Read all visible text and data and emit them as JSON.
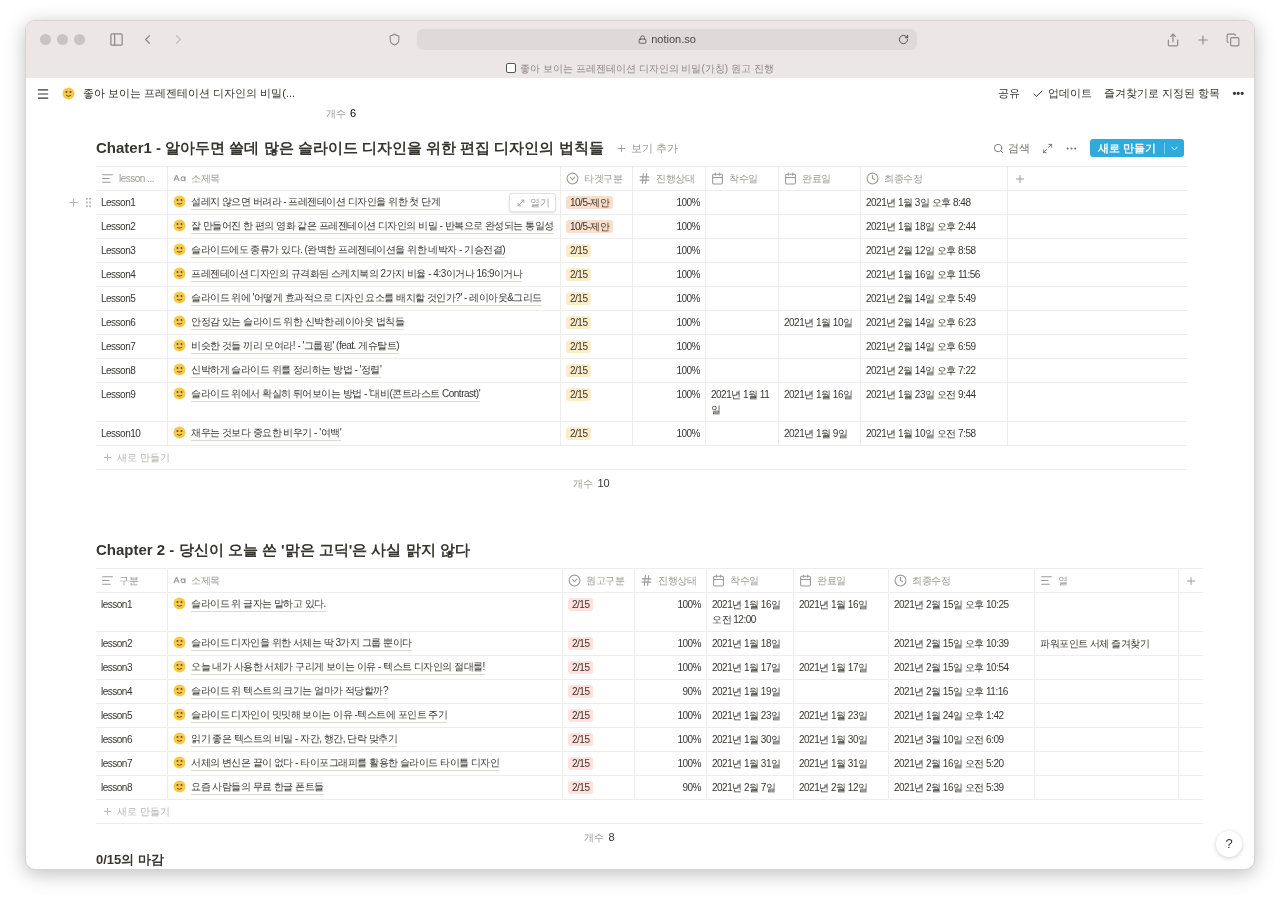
{
  "browser": {
    "url": "notion.so",
    "tab_title": "좋아 보이는 프레젠테이션 디자인의 비밀(가칭) 원고 진행"
  },
  "topbar": {
    "page_title": "좋아 보이는 프레젠테이션 디자인의 비밀(...",
    "actions": [
      {
        "kind": "text",
        "label": "공유"
      },
      {
        "kind": "check",
        "label": "업데이트"
      },
      {
        "kind": "text",
        "label": "즐겨찾기로 지정된 항목"
      },
      {
        "kind": "more",
        "label": "•••"
      }
    ]
  },
  "prev_count": {
    "label": "개수",
    "value": "6"
  },
  "tables": [
    {
      "title": "Chater1 - 알아두면 쓸데 많은 슬라이드 디자인을 위한 편집 디자인의 법칙들",
      "add_view": "보기 추가",
      "search": "검색",
      "new_button": "새로 만들기",
      "columns": [
        {
          "kind": "text",
          "label": "lesson ..."
        },
        {
          "kind": "title",
          "label": "소제목"
        },
        {
          "kind": "select",
          "label": "타겟구분"
        },
        {
          "kind": "number",
          "label": "진행상태"
        },
        {
          "kind": "date",
          "label": "착수일"
        },
        {
          "kind": "date",
          "label": "완료일"
        },
        {
          "kind": "clock",
          "label": "최종수정"
        },
        {
          "kind": "add"
        }
      ],
      "rows": [
        {
          "lesson": "Lesson1",
          "title": "설레지 않으면 버려라 - 프레젠테이션 디자인을 위한 첫 단계",
          "open_label": "열기",
          "tag": {
            "label": "10/5-제안",
            "color": "#fadec9"
          },
          "progress": "100%",
          "modified": "2021년 1월 3일 오후 8:48"
        },
        {
          "lesson": "Lesson2",
          "title": "잘 만들어진 한 편의 영화 같은 프레젠테이션 디자인의 비밀 - 반복으로 완성되는 통일성",
          "tag": {
            "label": "10/5-제안",
            "color": "#fadec9"
          },
          "progress": "100%",
          "modified": "2021년 1월 18일 오후 2:44"
        },
        {
          "lesson": "Lesson3",
          "title": "슬라이드에도 종류가 있다. (완벽한 프레젠테이션을 위한 네박자 - 기승전결)",
          "tag": {
            "label": "2/15",
            "color": "#fdecc8"
          },
          "progress": "100%",
          "modified": "2021년 2월 12일 오후 8:58"
        },
        {
          "lesson": "Lesson4",
          "title": "프레젠테이션 디자인의 규격화된 스케치북의 2가지 비율 - 4:3이거나 16:9이거나",
          "tag": {
            "label": "2/15",
            "color": "#fdecc8"
          },
          "progress": "100%",
          "modified": "2021년 1월 16일 오후 11:56"
        },
        {
          "lesson": "Lesson5",
          "title": "슬라이드 위에 '어떻게 효과적으로 디자인 요소를 배치할 것인가?' - 레이아웃&그리드",
          "tag": {
            "label": "2/15",
            "color": "#fdecc8"
          },
          "progress": "100%",
          "modified": "2021년 2월 14일 오후 5:49"
        },
        {
          "lesson": "Lesson6",
          "title": "안정감 있는 슬라이드 위한 신박한 레이아웃 법칙들",
          "tag": {
            "label": "2/15",
            "color": "#fdecc8"
          },
          "progress": "100%",
          "end": "2021년 1월 10일",
          "modified": "2021년 2월 14일 오후 6:23"
        },
        {
          "lesson": "Lesson7",
          "title": "비슷한 것들 끼리 모여라! - '그룹핑' (feat. 게슈탈트)",
          "tag": {
            "label": "2/15",
            "color": "#fdecc8"
          },
          "progress": "100%",
          "modified": "2021년 2월 14일 오후 6:59"
        },
        {
          "lesson": "Lesson8",
          "title": "신박하게 슬라이드 위를 정리하는 방법 - '정렬'",
          "tag": {
            "label": "2/15",
            "color": "#fdecc8"
          },
          "progress": "100%",
          "modified": "2021년 2월 14일 오후 7:22"
        },
        {
          "lesson": "Lesson9",
          "title": "슬라이드 위에서 확실히 튀어보이는 방법 - '대비(콘트라스트 Contrast)'",
          "tag": {
            "label": "2/15",
            "color": "#fdecc8"
          },
          "progress": "100%",
          "start": "2021년 1월 11일",
          "end": "2021년 1월 16일",
          "modified": "2021년 1월 23일 오전 9:44"
        },
        {
          "lesson": "Lesson10",
          "title": "채우는 것보다 중요한 비우기 - '여백'",
          "tag": {
            "label": "2/15",
            "color": "#fdecc8"
          },
          "progress": "100%",
          "end": "2021년 1월 9일",
          "modified": "2021년 1월 10일 오전 7:58"
        }
      ],
      "new_row": "새로 만들기",
      "count": {
        "label": "개수",
        "value": "10"
      }
    },
    {
      "title": "Chapter 2 - 당신이 오늘 쓴 '맑은 고딕'은 사실 맑지 않다",
      "columns": [
        {
          "kind": "text",
          "label": "구분"
        },
        {
          "kind": "title",
          "label": "소제목"
        },
        {
          "kind": "select",
          "label": "원고구분"
        },
        {
          "kind": "number",
          "label": "진행상태"
        },
        {
          "kind": "date",
          "label": "착수일"
        },
        {
          "kind": "date",
          "label": "완료일"
        },
        {
          "kind": "clock",
          "label": "최종수정"
        },
        {
          "kind": "text",
          "label": "열"
        },
        {
          "kind": "add"
        }
      ],
      "rows": [
        {
          "lesson": "lesson1",
          "title": "슬라이드 위 글자는 말하고 있다.",
          "tag": {
            "label": "2/15",
            "color": "#ffe2dd"
          },
          "progress": "100%",
          "start": "2021년 1월 16일 오전 12:00",
          "end": "2021년 1월 16일",
          "modified": "2021년 2월 15일 오후 10:25"
        },
        {
          "lesson": "lesson2",
          "title": "슬라이드 디자인을 위한 서체는 딱 3가지 그룹 뿐이다",
          "tag": {
            "label": "2/15",
            "color": "#ffe2dd"
          },
          "progress": "100%",
          "start": "2021년 1월 18일",
          "modified": "2021년 2월 15일 오후 10:39",
          "note": "파워포인트 서체 즐겨찾기"
        },
        {
          "lesson": "lesson3",
          "title": "오늘 내가 사용한 서체가 구리게 보이는 이유 - 텍스트 디자인의 절대룰!",
          "tag": {
            "label": "2/15",
            "color": "#ffe2dd"
          },
          "progress": "100%",
          "start": "2021년 1월 17일",
          "end": "2021년 1월 17일",
          "modified": "2021년 2월 15일 오후 10:54"
        },
        {
          "lesson": "lesson4",
          "title": "슬라이드 위 텍스트의 크기는 얼마가 적당할까?",
          "tag": {
            "label": "2/15",
            "color": "#ffe2dd"
          },
          "progress": "90%",
          "start": "2021년 1월 19일",
          "modified": "2021년 2월 15일 오후 11:16"
        },
        {
          "lesson": "lesson5",
          "title": "슬라이드 디자인이 밋밋해 보이는 이유 -텍스트에 포인트 주기",
          "tag": {
            "label": "2/15",
            "color": "#ffe2dd"
          },
          "progress": "100%",
          "start": "2021년 1월 23일",
          "end": "2021년 1월 23일",
          "modified": "2021년 1월 24일 오후 1:42"
        },
        {
          "lesson": "lesson6",
          "title": "읽기 좋은 텍스트의 비밀 - 자간, 행간, 단락 맞추기",
          "tag": {
            "label": "2/15",
            "color": "#ffe2dd"
          },
          "progress": "100%",
          "start": "2021년 1월 30일",
          "end": "2021년 1월 30일",
          "modified": "2021년 3월 10일 오전 6:09"
        },
        {
          "lesson": "lesson7",
          "title": "서체의 변신은 끝이 없다 - 타이포그래피를 활용한 슬라이드 타이틀 디자인",
          "tag": {
            "label": "2/15",
            "color": "#ffe2dd"
          },
          "progress": "100%",
          "start": "2021년 1월 31일",
          "end": "2021년 1월 31일",
          "modified": "2021년 2월 16일 오전 5:20"
        },
        {
          "lesson": "lesson8",
          "title": "요즘 사람들의 무료 한글 폰트들",
          "tag": {
            "label": "2/15",
            "color": "#ffe2dd"
          },
          "progress": "90%",
          "start": "2021년 2월 7일",
          "end": "2021년 2월 12일",
          "modified": "2021년 2월 16일 오전 5:39"
        }
      ],
      "new_row": "새로 만들기",
      "count": {
        "label": "개수",
        "value": "8"
      }
    }
  ],
  "next_heading": "0/15의 마감",
  "help": "?"
}
